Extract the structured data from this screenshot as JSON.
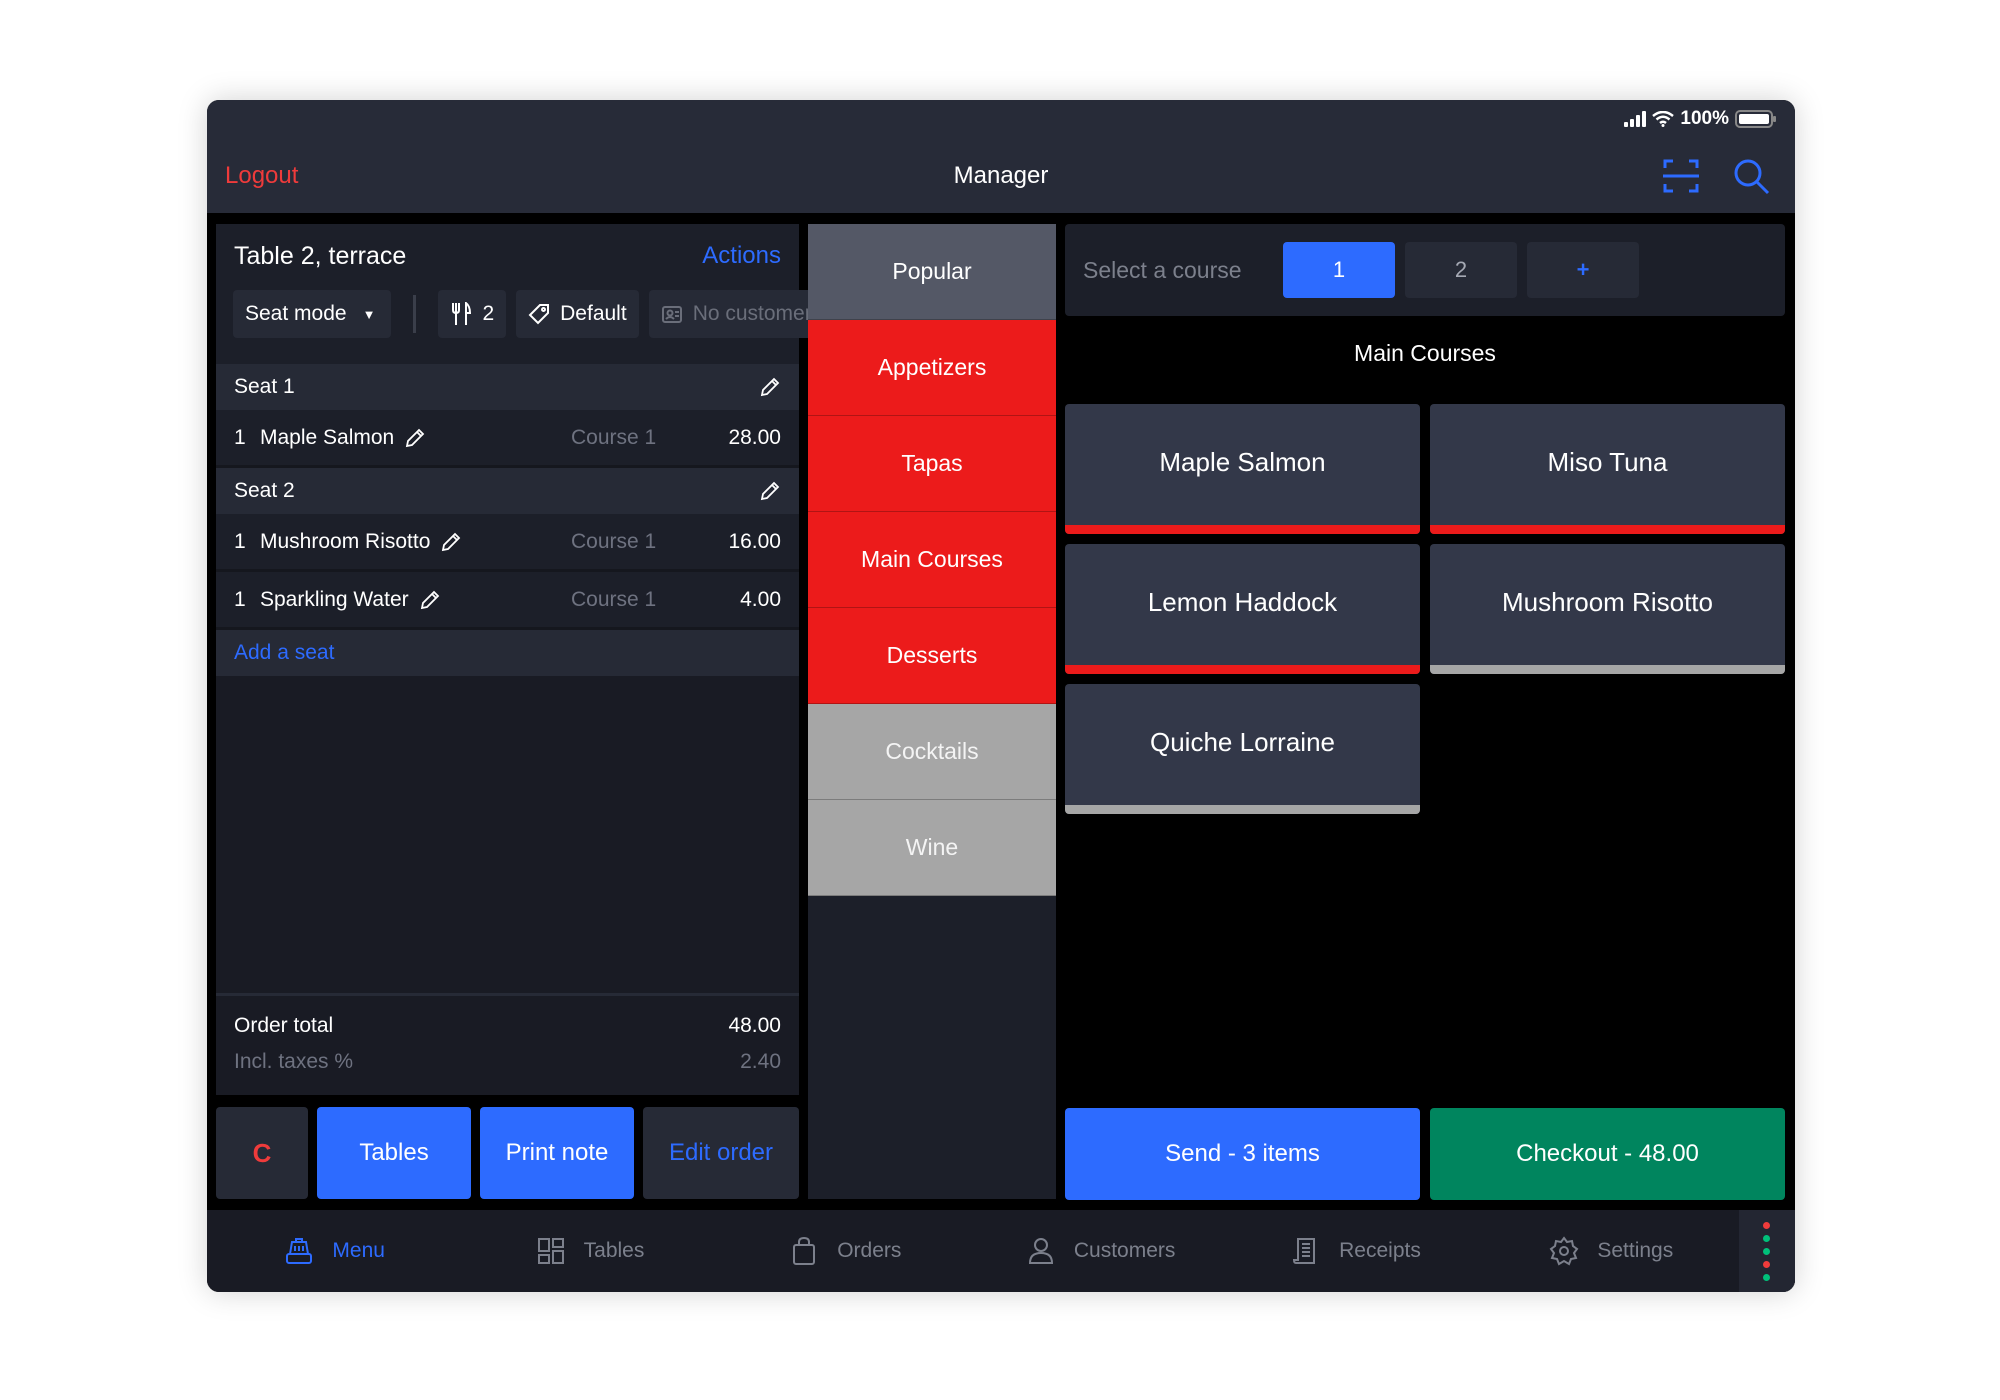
{
  "status_bar": {
    "battery_text": "100%",
    "battery_level": 1.0
  },
  "header": {
    "logout_label": "Logout",
    "title": "Manager",
    "icons": [
      "scan-icon",
      "search-icon"
    ]
  },
  "order": {
    "table_title": "Table 2, terrace",
    "actions_label": "Actions",
    "seat_mode_label": "Seat mode",
    "guests_count": "2",
    "price_list_label": "Default",
    "customer_label": "No customer",
    "seats": [
      {
        "label": "Seat 1",
        "items": [
          {
            "qty": "1",
            "name": "Maple Salmon",
            "course": "Course 1",
            "price": "28.00"
          }
        ]
      },
      {
        "label": "Seat 2",
        "items": [
          {
            "qty": "1",
            "name": "Mushroom Risotto",
            "course": "Course 1",
            "price": "16.00"
          },
          {
            "qty": "1",
            "name": "Sparkling Water",
            "course": "Course 1",
            "price": "4.00"
          }
        ]
      }
    ],
    "add_seat_label": "Add a seat",
    "total_label": "Order total",
    "total_value": "48.00",
    "tax_label": "Incl. taxes %",
    "tax_value": "2.40"
  },
  "left_buttons": {
    "clear": "C",
    "tables": "Tables",
    "print_note": "Print note",
    "edit_order": "Edit order"
  },
  "categories": [
    {
      "label": "Popular",
      "style": "gray"
    },
    {
      "label": "Appetizers",
      "style": "red"
    },
    {
      "label": "Tapas",
      "style": "red"
    },
    {
      "label": "Main Courses",
      "style": "red"
    },
    {
      "label": "Desserts",
      "style": "red"
    },
    {
      "label": "Cocktails",
      "style": "light"
    },
    {
      "label": "Wine",
      "style": "light"
    }
  ],
  "courses": {
    "label": "Select a course",
    "options": [
      "1",
      "2",
      "+"
    ],
    "selected": "1"
  },
  "products": {
    "section_title": "Main Courses",
    "items": [
      {
        "name": "Maple Salmon",
        "bar_color": "#ec1b1b"
      },
      {
        "name": "Miso Tuna",
        "bar_color": "#ec1b1b"
      },
      {
        "name": "Lemon Haddock",
        "bar_color": "#ec1b1b"
      },
      {
        "name": "Mushroom Risotto",
        "bar_color": "#a6a6a6"
      },
      {
        "name": "Quiche Lorraine",
        "bar_color": "#a6a6a6"
      }
    ]
  },
  "actions": {
    "send_label": "Send - 3 items",
    "checkout_label": "Checkout - 48.00"
  },
  "tabs": [
    {
      "label": "Menu",
      "icon": "cash-register-icon",
      "active": true
    },
    {
      "label": "Tables",
      "icon": "grid-icon",
      "active": false
    },
    {
      "label": "Orders",
      "icon": "bag-icon",
      "active": false
    },
    {
      "label": "Customers",
      "icon": "users-icon",
      "active": false
    },
    {
      "label": "Receipts",
      "icon": "receipt-icon",
      "active": false
    },
    {
      "label": "Settings",
      "icon": "gear-icon",
      "active": false
    }
  ],
  "status_dots": [
    "#ef3b3b",
    "#00c07a",
    "#00c07a",
    "#ef3b3b",
    "#00c07a"
  ],
  "colors": {
    "accent": "#2d6bff",
    "danger": "#ec1b1b",
    "success": "#00855e"
  }
}
